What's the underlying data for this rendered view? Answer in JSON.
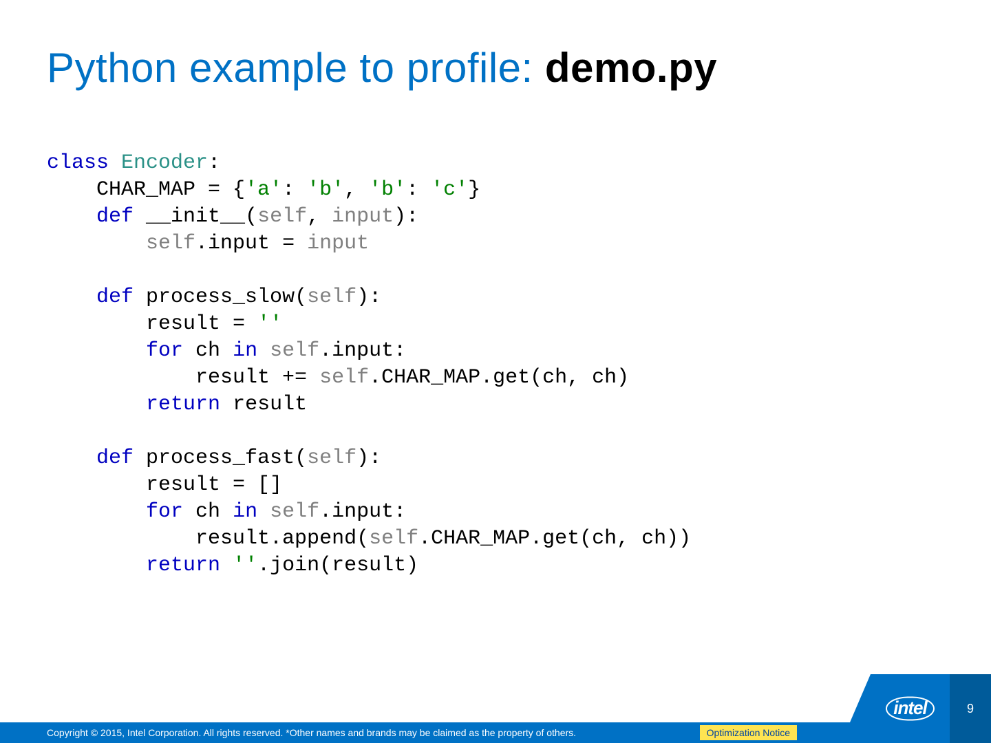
{
  "title": {
    "prefix": "Python example to profile: ",
    "filename": "demo.py"
  },
  "code": {
    "tokens": [
      {
        "t": "class ",
        "c": "kw"
      },
      {
        "t": "Encoder",
        "c": "cls"
      },
      {
        "t": ":\n"
      },
      {
        "t": "    CHAR_MAP = {"
      },
      {
        "t": "'a'",
        "c": "str"
      },
      {
        "t": ": "
      },
      {
        "t": "'b'",
        "c": "str"
      },
      {
        "t": ", "
      },
      {
        "t": "'b'",
        "c": "str"
      },
      {
        "t": ": "
      },
      {
        "t": "'c'",
        "c": "str"
      },
      {
        "t": "}\n"
      },
      {
        "t": "    "
      },
      {
        "t": "def ",
        "c": "kw"
      },
      {
        "t": "__init__("
      },
      {
        "t": "self",
        "c": "gray"
      },
      {
        "t": ", "
      },
      {
        "t": "input",
        "c": "gray"
      },
      {
        "t": "):\n"
      },
      {
        "t": "        "
      },
      {
        "t": "self",
        "c": "gray"
      },
      {
        "t": ".input = "
      },
      {
        "t": "input",
        "c": "gray"
      },
      {
        "t": "\n"
      },
      {
        "t": "\n"
      },
      {
        "t": "    "
      },
      {
        "t": "def ",
        "c": "kw"
      },
      {
        "t": "process_slow("
      },
      {
        "t": "self",
        "c": "gray"
      },
      {
        "t": "):\n"
      },
      {
        "t": "        result = "
      },
      {
        "t": "''",
        "c": "str"
      },
      {
        "t": "\n"
      },
      {
        "t": "        "
      },
      {
        "t": "for ",
        "c": "kw"
      },
      {
        "t": "ch "
      },
      {
        "t": "in ",
        "c": "kw"
      },
      {
        "t": "self",
        "c": "gray"
      },
      {
        "t": ".input:\n"
      },
      {
        "t": "            result += "
      },
      {
        "t": "self",
        "c": "gray"
      },
      {
        "t": ".CHAR_MAP.get(ch, ch)\n"
      },
      {
        "t": "        "
      },
      {
        "t": "return ",
        "c": "kw"
      },
      {
        "t": "result\n"
      },
      {
        "t": "\n"
      },
      {
        "t": "    "
      },
      {
        "t": "def ",
        "c": "kw"
      },
      {
        "t": "process_fast("
      },
      {
        "t": "self",
        "c": "gray"
      },
      {
        "t": "):\n"
      },
      {
        "t": "        result = []\n"
      },
      {
        "t": "        "
      },
      {
        "t": "for ",
        "c": "kw"
      },
      {
        "t": "ch "
      },
      {
        "t": "in ",
        "c": "kw"
      },
      {
        "t": "self",
        "c": "gray"
      },
      {
        "t": ".input:\n"
      },
      {
        "t": "            result.append("
      },
      {
        "t": "self",
        "c": "gray"
      },
      {
        "t": ".CHAR_MAP.get(ch, ch))\n"
      },
      {
        "t": "        "
      },
      {
        "t": "return ",
        "c": "kw"
      },
      {
        "t": "''",
        "c": "str"
      },
      {
        "t": ".join(result)"
      }
    ]
  },
  "footer": {
    "copyright": "Copyright ©  2015, Intel Corporation. All rights reserved. *Other names and brands may be claimed as the property of others.",
    "optimization_notice": "Optimization Notice",
    "logo_text": "intel",
    "page_number": "9"
  },
  "colors": {
    "intel_blue": "#0071c5",
    "dark_blue": "#005b9a",
    "yellow": "#ffe452",
    "kw": "#0000c0",
    "cls": "#2b9187",
    "gray": "#808080",
    "str": "#008000"
  }
}
